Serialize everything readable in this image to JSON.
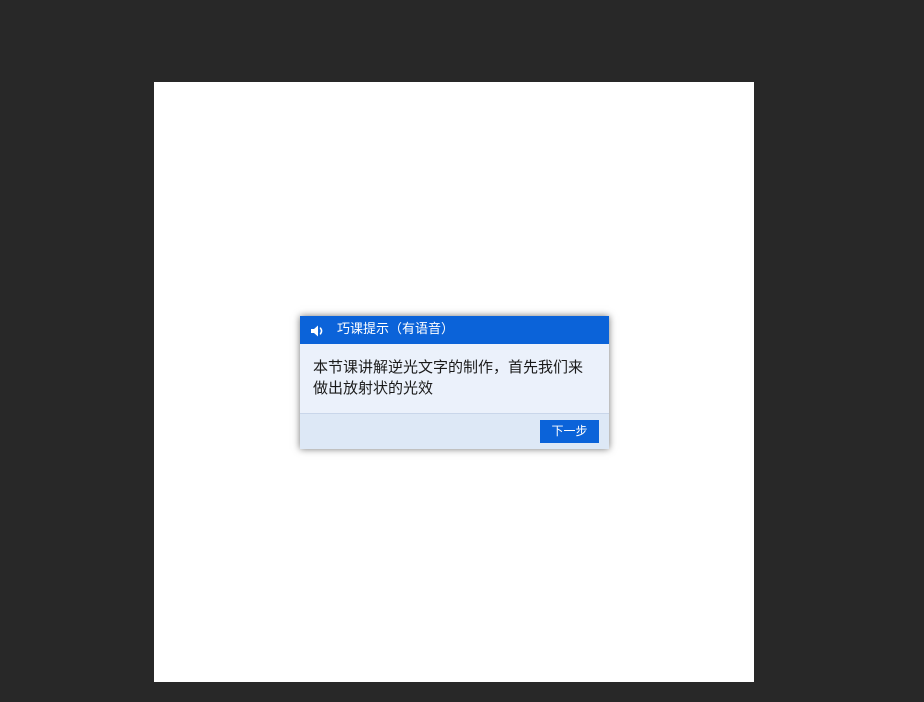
{
  "dialog": {
    "title": "巧课提示（有语音）",
    "title_icon": "speaker-icon",
    "message": "本节课讲解逆光文字的制作，首先我们来做出放射状的光效",
    "next_button_label": "下一步"
  },
  "colors": {
    "workspace_background": "#282828",
    "canvas_background": "#ffffff",
    "dialog_header": "#0b63d9",
    "dialog_body": "#ebf1fb",
    "button": "#0b63d9"
  }
}
